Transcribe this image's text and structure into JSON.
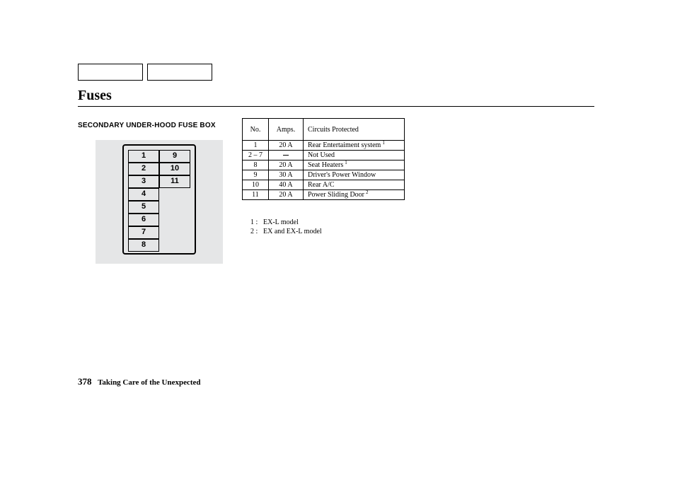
{
  "title": "Fuses",
  "subtitle": "SECONDARY UNDER-HOOD FUSE BOX",
  "diagram": {
    "left_column": [
      "1",
      "2",
      "3",
      "4",
      "5",
      "6",
      "7",
      "8"
    ],
    "right_column": [
      "9",
      "10",
      "11"
    ]
  },
  "table": {
    "headers": {
      "no": "No.",
      "amps": "Amps.",
      "circuits": "Circuits Protected"
    },
    "rows": [
      {
        "no": "1",
        "amps": "20 A",
        "circuit": "Rear Entertaiment system",
        "sup": "1"
      },
      {
        "no": "2 – 7",
        "amps": "",
        "circuit": "Not Used",
        "sup": ""
      },
      {
        "no": "8",
        "amps": "20 A",
        "circuit": "Seat Heaters",
        "sup": "1"
      },
      {
        "no": "9",
        "amps": "30 A",
        "circuit": "Driver's Power Window",
        "sup": ""
      },
      {
        "no": "10",
        "amps": "40 A",
        "circuit": "Rear A/C",
        "sup": ""
      },
      {
        "no": "11",
        "amps": "20 A",
        "circuit": "Power Sliding Door",
        "sup": "2"
      }
    ]
  },
  "footnotes": [
    {
      "num": "1 :",
      "text": "EX-L model"
    },
    {
      "num": "2 :",
      "text": "EX and EX-L model"
    }
  ],
  "footer": {
    "page": "378",
    "text": "Taking Care of the Unexpected"
  }
}
